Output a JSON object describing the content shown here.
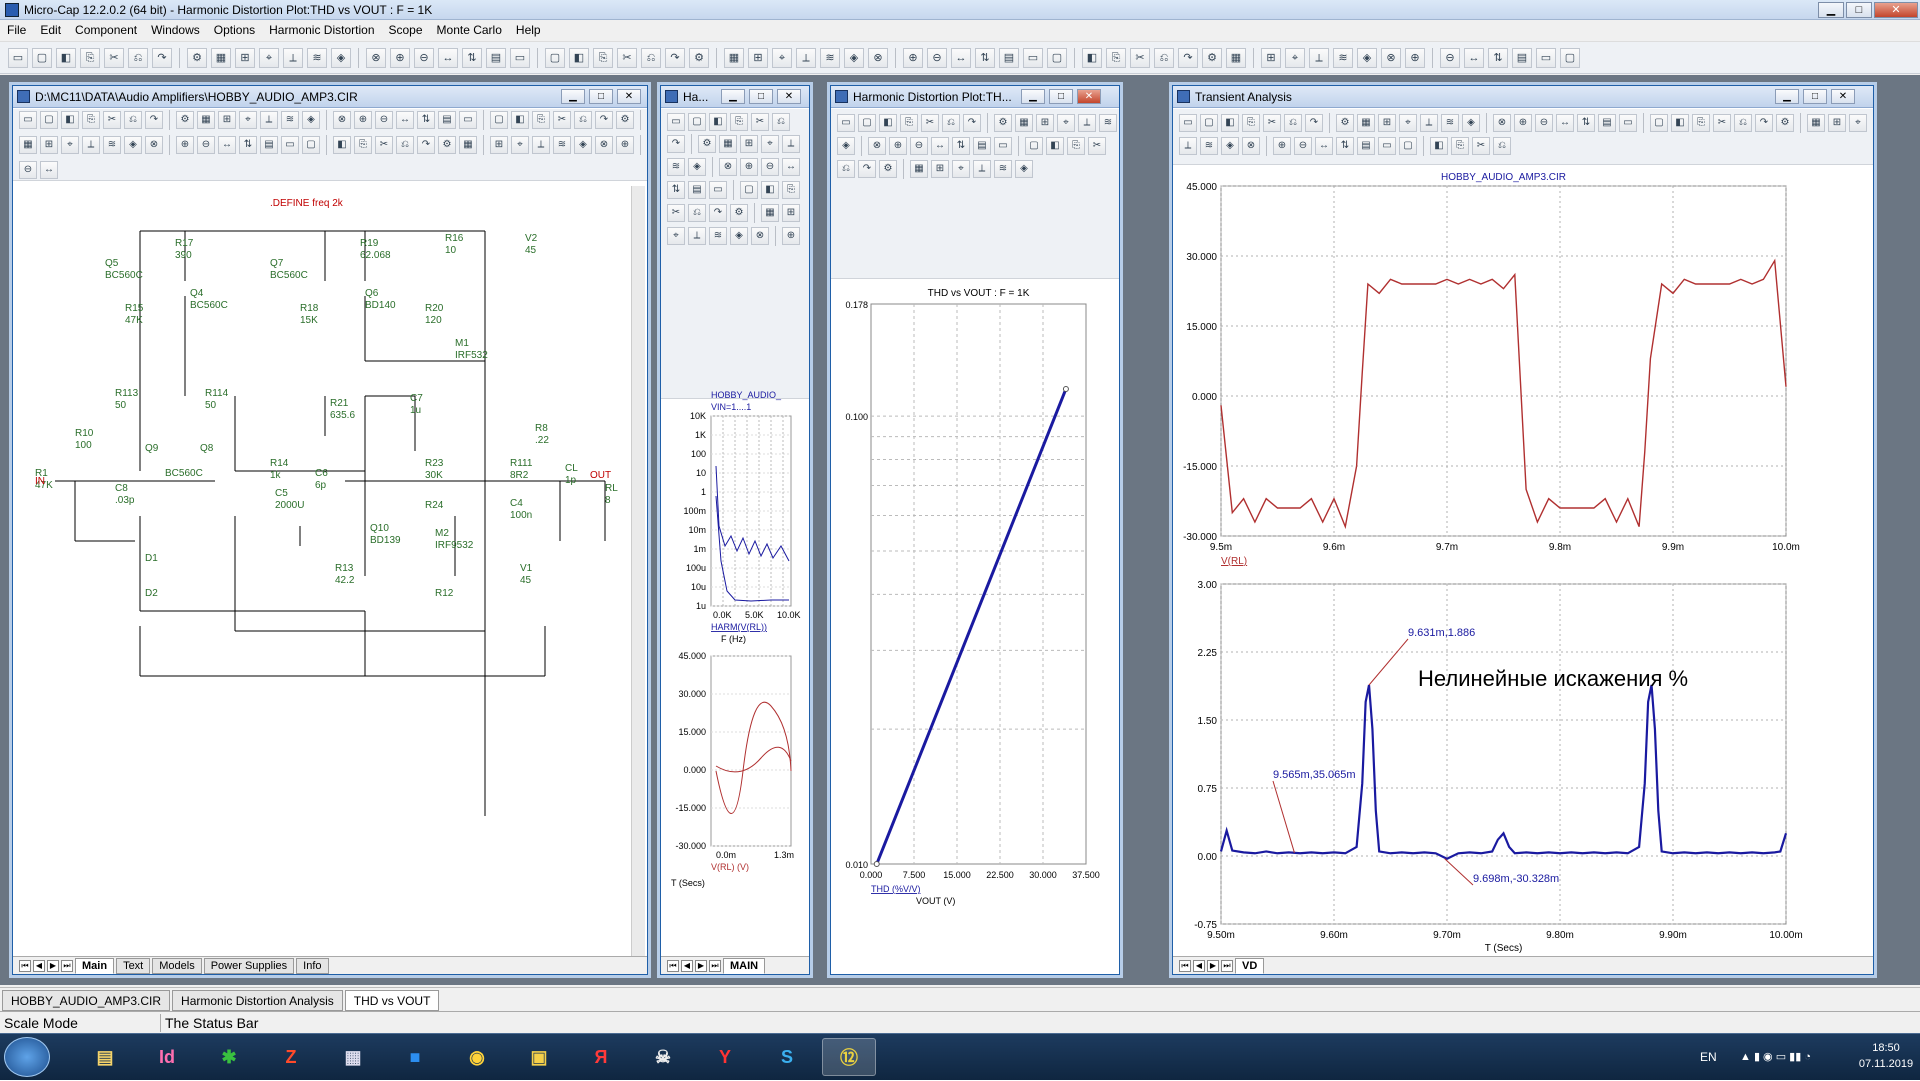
{
  "app": {
    "title": "Micro-Cap 12.2.0.2 (64 bit) - Harmonic Distortion Plot:THD vs VOUT : F = 1K",
    "min_label": "▁",
    "max_label": "□",
    "close_label": "✕"
  },
  "menu": [
    "File",
    "Edit",
    "Component",
    "Windows",
    "Options",
    "Harmonic Distortion",
    "Scope",
    "Monte Carlo",
    "Help"
  ],
  "schematic": {
    "title": "D:\\MC11\\DATA\\Audio Amplifiers\\HOBBY_AUDIO_AMP3.CIR",
    "define": ".DEFINE freq 2k",
    "labels": [
      {
        "t": "R17",
        "v": "390"
      },
      {
        "t": "R19",
        "v": "62.068"
      },
      {
        "t": "R16",
        "v": "10"
      },
      {
        "t": "V2",
        "v": "45"
      },
      {
        "t": "Q5",
        "v": "BC560C"
      },
      {
        "t": "Q4",
        "v": "BC560C"
      },
      {
        "t": "Q7",
        "v": "BC560C"
      },
      {
        "t": "Q6",
        "v": "BD140"
      },
      {
        "t": "R15",
        "v": "47K"
      },
      {
        "t": "R18",
        "v": "15K"
      },
      {
        "t": "R20",
        "v": "120"
      },
      {
        "t": "M1",
        "v": "IRF532"
      },
      {
        "t": "R113",
        "v": "50"
      },
      {
        "t": "R114",
        "v": "50"
      },
      {
        "t": "R21",
        "v": "635.6"
      },
      {
        "t": "C7",
        "v": "1u"
      },
      {
        "t": "R10",
        "v": "100"
      },
      {
        "t": "Q9",
        "v": ""
      },
      {
        "t": "Q8",
        "v": ""
      },
      {
        "t": "BC560C",
        "v": ""
      },
      {
        "t": "R8",
        "v": ".22"
      },
      {
        "t": "R1",
        "v": "47K"
      },
      {
        "t": "C8",
        "v": ".03p"
      },
      {
        "t": "R14",
        "v": "1k"
      },
      {
        "t": "C6",
        "v": "6p"
      },
      {
        "t": "R23",
        "v": "30K"
      },
      {
        "t": "R111",
        "v": "8R2"
      },
      {
        "t": "CL",
        "v": "1p"
      },
      {
        "t": "RL",
        "v": "8"
      },
      {
        "t": "C5",
        "v": "2000U"
      },
      {
        "t": "R24",
        "v": ""
      },
      {
        "t": "C4",
        "v": "100n"
      },
      {
        "t": "Q10",
        "v": "BD139"
      },
      {
        "t": "M2",
        "v": "IRF9532"
      },
      {
        "t": "D1",
        "v": ""
      },
      {
        "t": "D2",
        "v": ""
      },
      {
        "t": "R13",
        "v": "42.2"
      },
      {
        "t": "R12",
        "v": ""
      },
      {
        "t": "V1",
        "v": "45"
      }
    ],
    "in_label": "IN",
    "out_label": "OUT",
    "tabs": [
      "Main",
      "Text",
      "Models",
      "Power Supplies",
      "Info"
    ]
  },
  "ha_window": {
    "title": "Ha...",
    "harm_title": "HOBBY_AUDIO_",
    "harm_sub": "VIN=1....1",
    "harm_yticks": [
      "10K",
      "1K",
      "100",
      "10",
      "1",
      "100m",
      "10m",
      "1m",
      "100u",
      "10u",
      "1u"
    ],
    "harm_xticks": [
      "0.0K",
      "5.0K",
      "10.0K"
    ],
    "harm_xlabel": "HARM(V(RL))",
    "harm_unit": "F (Hz)",
    "wave_yticks": [
      "45.000",
      "30.000",
      "15.000",
      "0.000",
      "-15.000",
      "-30.000"
    ],
    "wave_xticks": [
      "0.0m",
      "1.3m"
    ],
    "wave_xlabel": "V(RL) (V)",
    "wave_unit": "T (Secs)",
    "tabs": [
      "MAIN"
    ]
  },
  "thd_window": {
    "title": "Harmonic Distortion Plot:TH...",
    "chart_data": {
      "type": "line",
      "title": "THD vs VOUT : F = 1K",
      "xlabel": "VOUT (V)",
      "ylabel": "THD (%V/V)",
      "ytick_labels": [
        "0.178",
        "0.100",
        "0.010"
      ],
      "xtick_labels": [
        "0.000",
        "7.500",
        "15.000",
        "22.500",
        "30.000",
        "37.500"
      ],
      "xlim": [
        0,
        37.5
      ],
      "series": [
        {
          "name": "THD (%V/V)",
          "x": [
            1.0,
            34.0
          ],
          "y": [
            0.01,
            0.115
          ]
        }
      ]
    }
  },
  "transient_window": {
    "title": "Transient Analysis",
    "plot1": {
      "type": "line",
      "title": "HOBBY_AUDIO_AMP3.CIR",
      "ytick_labels": [
        "45.000",
        "30.000",
        "15.000",
        "0.000",
        "-15.000",
        "-30.000"
      ],
      "xtick_labels": [
        "9.5m",
        "9.6m",
        "9.7m",
        "9.8m",
        "9.9m",
        "10.0m"
      ],
      "ylim": [
        -30,
        45
      ],
      "xlim": [
        9.5,
        10.0
      ],
      "series_label": "V(RL)",
      "x": [
        9.5,
        9.51,
        9.52,
        9.53,
        9.54,
        9.55,
        9.56,
        9.57,
        9.58,
        9.59,
        9.6,
        9.61,
        9.62,
        9.625,
        9.63,
        9.64,
        9.65,
        9.66,
        9.67,
        9.68,
        9.69,
        9.7,
        9.71,
        9.72,
        9.73,
        9.74,
        9.75,
        9.76,
        9.77,
        9.78,
        9.79,
        9.8,
        9.81,
        9.82,
        9.83,
        9.84,
        9.85,
        9.86,
        9.87,
        9.875,
        9.88,
        9.89,
        9.9,
        9.91,
        9.92,
        9.93,
        9.94,
        9.95,
        9.96,
        9.97,
        9.98,
        9.99,
        10.0
      ],
      "y": [
        -2,
        -25,
        -22,
        -27,
        -22,
        -24,
        -24,
        -24,
        -22,
        -27,
        -22,
        -28,
        -15,
        5,
        24,
        22,
        25,
        24,
        24,
        24,
        24,
        25,
        24,
        25,
        24,
        25,
        23,
        26,
        -20,
        -27,
        -22,
        -24,
        -24,
        -24,
        -24,
        -22,
        -27,
        -22,
        -28,
        -12,
        8,
        24,
        22,
        25,
        24,
        24,
        24,
        24,
        25,
        24,
        25,
        29,
        2
      ]
    },
    "plot2": {
      "type": "line",
      "title": "Нелинейные искажения %",
      "ytick_labels": [
        "3.00",
        "2.25",
        "1.50",
        "0.75",
        "0.00",
        "-0.75"
      ],
      "xtick_labels": [
        "9.50m",
        "9.60m",
        "9.70m",
        "9.80m",
        "9.90m",
        "10.00m"
      ],
      "ylim": [
        -0.75,
        3.0
      ],
      "xlim": [
        9.5,
        10.0
      ],
      "xlabel": "T (Secs)",
      "annotations": [
        "9.631m,1.886",
        "9.565m,35.065m",
        "9.698m,-30.328m"
      ],
      "x": [
        9.5,
        9.505,
        9.51,
        9.52,
        9.53,
        9.54,
        9.55,
        9.56,
        9.57,
        9.58,
        9.59,
        9.6,
        9.61,
        9.62,
        9.625,
        9.628,
        9.631,
        9.634,
        9.637,
        9.64,
        9.65,
        9.66,
        9.67,
        9.68,
        9.69,
        9.7,
        9.71,
        9.72,
        9.73,
        9.74,
        9.745,
        9.75,
        9.755,
        9.76,
        9.77,
        9.78,
        9.79,
        9.8,
        9.81,
        9.82,
        9.83,
        9.84,
        9.85,
        9.86,
        9.87,
        9.875,
        9.878,
        9.881,
        9.884,
        9.887,
        9.89,
        9.9,
        9.91,
        9.92,
        9.93,
        9.94,
        9.95,
        9.96,
        9.97,
        9.98,
        9.99,
        9.995,
        10.0
      ],
      "y": [
        0.05,
        0.28,
        0.06,
        0.04,
        0.03,
        0.05,
        0.03,
        0.04,
        0.03,
        0.04,
        0.03,
        0.04,
        0.03,
        0.1,
        0.8,
        1.7,
        1.886,
        1.4,
        0.5,
        0.05,
        0.03,
        0.04,
        0.03,
        0.04,
        0.03,
        -0.03,
        0.03,
        0.04,
        0.03,
        0.05,
        0.18,
        0.25,
        0.1,
        0.03,
        0.04,
        0.03,
        0.04,
        0.03,
        0.04,
        0.03,
        0.04,
        0.03,
        0.04,
        0.03,
        0.1,
        0.8,
        1.7,
        1.886,
        1.4,
        0.5,
        0.05,
        0.03,
        0.04,
        0.03,
        0.04,
        0.03,
        0.04,
        0.03,
        0.04,
        0.03,
        0.04,
        0.05,
        0.25
      ]
    },
    "tabs": [
      "VD"
    ]
  },
  "doc_tabs": [
    "HOBBY_AUDIO_AMP3.CIR",
    "Harmonic Distortion Analysis",
    "THD vs VOUT"
  ],
  "status": {
    "mode": "Scale Mode",
    "text": "The Status Bar"
  },
  "taskbar": {
    "lang": "EN",
    "time": "18:50",
    "date": "07.11.2019"
  },
  "colors": {
    "trace_red": "#b03030",
    "trace_blue": "#1a1aa0",
    "schem_green": "#2a6e2a",
    "schem_red": "#c00000",
    "grid": "#b0b0b0"
  }
}
